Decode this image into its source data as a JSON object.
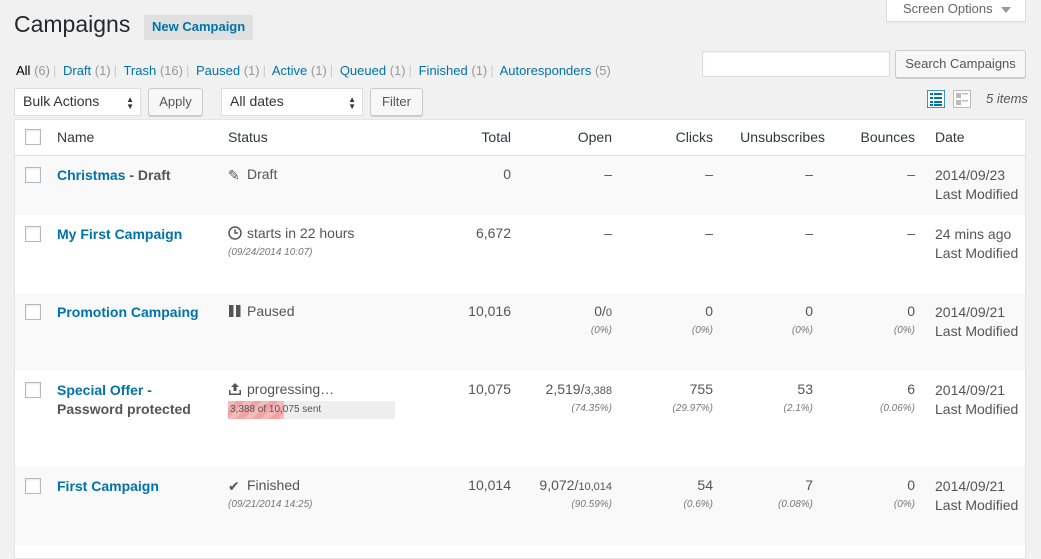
{
  "screen_options": "Screen Options",
  "title": "Campaigns",
  "new_campaign": "New Campaign",
  "filters": [
    {
      "label": "All",
      "count": "(6)",
      "current": true
    },
    {
      "label": "Draft",
      "count": "(1)"
    },
    {
      "label": "Trash",
      "count": "(16)"
    },
    {
      "label": "Paused",
      "count": "(1)"
    },
    {
      "label": "Active",
      "count": "(1)"
    },
    {
      "label": "Queued",
      "count": "(1)"
    },
    {
      "label": "Finished",
      "count": "(1)"
    },
    {
      "label": "Autoresponders",
      "count": "(5)"
    }
  ],
  "search": {
    "value": "",
    "button": "Search Campaigns"
  },
  "bulk_actions": "Bulk Actions",
  "apply": "Apply",
  "dates": "All dates",
  "filter": "Filter",
  "items_count": "5 items",
  "columns": {
    "name": "Name",
    "status": "Status",
    "total": "Total",
    "open": "Open",
    "clicks": "Clicks",
    "unsubscribes": "Unsubscribes",
    "bounces": "Bounces",
    "date": "Date"
  },
  "rows": [
    {
      "name": "Christmas",
      "suffix": " - Draft",
      "status_icon": "pencil-icon",
      "status": "Draft",
      "status_sub": "",
      "total": "0",
      "open": "–",
      "open_small": "",
      "open_pct": "",
      "clicks": "–",
      "clicks_pct": "",
      "unsub": "–",
      "unsub_pct": "",
      "bounces": "–",
      "bounces_pct": "",
      "date": "2014/09/23",
      "date_sub": "Last Modified"
    },
    {
      "name": "My First Campaign",
      "suffix": "",
      "status_icon": "clock-icon",
      "status": "starts in 22 hours",
      "status_sub": "(09/24/2014 10:07)",
      "total": "6,672",
      "open": "–",
      "open_small": "",
      "open_pct": "",
      "clicks": "–",
      "clicks_pct": "",
      "unsub": "–",
      "unsub_pct": "",
      "bounces": "–",
      "bounces_pct": "",
      "date": "24 mins ago",
      "date_sub": "Last Modified"
    },
    {
      "name": "Promotion Campaing",
      "suffix": "",
      "status_icon": "pause-icon",
      "status": "Paused",
      "status_sub": "",
      "total": "10,016",
      "open": "0/",
      "open_small": "0",
      "open_pct": "(0%)",
      "clicks": "0",
      "clicks_pct": "(0%)",
      "unsub": "0",
      "unsub_pct": "(0%)",
      "bounces": "0",
      "bounces_pct": "(0%)",
      "date": "2014/09/21",
      "date_sub": "Last Modified"
    },
    {
      "name": "Special Offer -",
      "suffix": "Password protected",
      "status_icon": "upload-icon",
      "status": "progressing…",
      "status_sub": "",
      "progress_text": "3,388 of 10,075 sent",
      "progress_fraction": 0.336,
      "total": "10,075",
      "open": "2,519/",
      "open_small": "3,388",
      "open_pct": "(74.35%)",
      "clicks": "755",
      "clicks_pct": "(29.97%)",
      "unsub": "53",
      "unsub_pct": "(2.1%)",
      "bounces": "6",
      "bounces_pct": "(0.06%)",
      "date": "2014/09/21",
      "date_sub": "Last Modified"
    },
    {
      "name": "First Campaign",
      "suffix": "",
      "status_icon": "check-icon",
      "status": "Finished",
      "status_sub": "(09/21/2014 14:25)",
      "total": "10,014",
      "open": "9,072/",
      "open_small": "10,014",
      "open_pct": "(90.59%)",
      "clicks": "54",
      "clicks_pct": "(0.6%)",
      "unsub": "7",
      "unsub_pct": "(0.08%)",
      "bounces": "0",
      "bounces_pct": "(0%)",
      "date": "2014/09/21",
      "date_sub": "Last Modified"
    }
  ]
}
